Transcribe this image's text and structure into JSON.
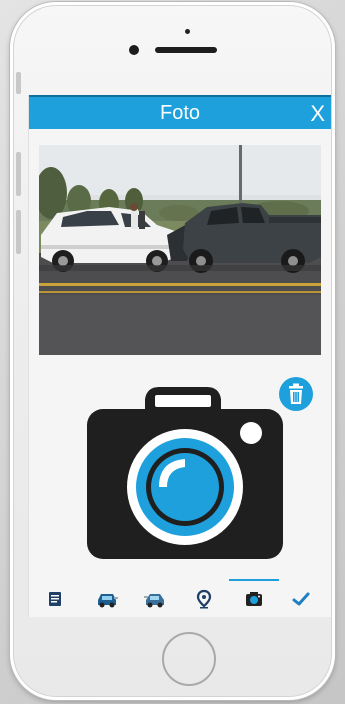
{
  "header": {
    "title": "Foto",
    "close_label": "X"
  },
  "colors": {
    "accent": "#1ea0dc",
    "icon_dark": "#222222",
    "tab_active": "#1ea0dc"
  },
  "photo": {
    "description_icon": "accident-photo"
  },
  "actions": {
    "delete_icon": "trash-icon",
    "capture_icon": "camera-icon"
  },
  "tabs": [
    {
      "icon": "document-icon",
      "active": false
    },
    {
      "icon": "car-front-icon",
      "active": false
    },
    {
      "icon": "car-side-icon",
      "active": false
    },
    {
      "icon": "location-pin-icon",
      "active": false
    },
    {
      "icon": "camera-icon",
      "active": true
    },
    {
      "icon": "checkmark-icon",
      "active": false
    }
  ]
}
